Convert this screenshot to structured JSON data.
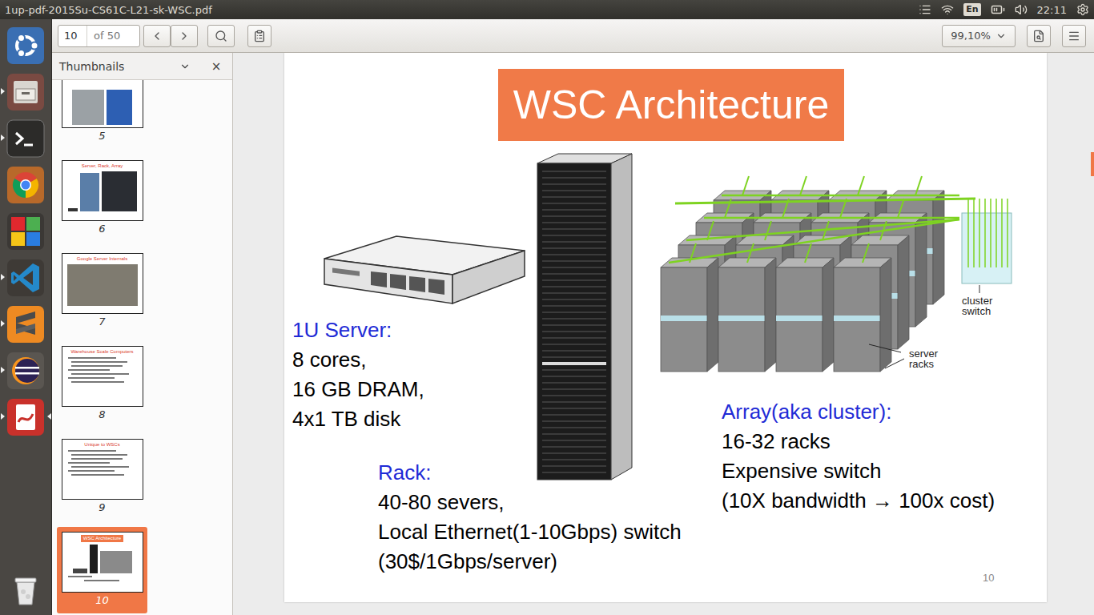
{
  "panel": {
    "title": "1up-pdf-2015Su-CS61C-L21-sk-WSC.pdf",
    "keyboard": "En",
    "time": "22:11"
  },
  "launcher": {
    "items": [
      {
        "kind": "dash",
        "running": false,
        "focused": false
      },
      {
        "kind": "files",
        "running": true,
        "focused": false
      },
      {
        "kind": "terminal",
        "running": true,
        "focused": false
      },
      {
        "kind": "chrome",
        "running": false,
        "focused": false
      },
      {
        "kind": "tiles",
        "running": false,
        "focused": false
      },
      {
        "kind": "vscode",
        "running": true,
        "focused": false
      },
      {
        "kind": "sublime",
        "running": true,
        "focused": false
      },
      {
        "kind": "eclipse",
        "running": true,
        "focused": false
      },
      {
        "kind": "pdf",
        "running": true,
        "focused": true
      },
      {
        "kind": "trash",
        "running": false,
        "focused": false
      }
    ]
  },
  "toolbar": {
    "page": "10",
    "page_count": "of 50",
    "zoom": "99,10%"
  },
  "sidebar": {
    "title": "Thumbnails",
    "close": "×",
    "thumbnails": [
      {
        "page": "5",
        "title": "",
        "kind": "photos",
        "selected": false
      },
      {
        "page": "6",
        "title": "Server, Rack, Array",
        "kind": "photo-row",
        "selected": false
      },
      {
        "page": "7",
        "title": "Google Server Internals",
        "kind": "photo",
        "selected": false
      },
      {
        "page": "8",
        "title": "Warehouse Scale Computers",
        "kind": "bullets",
        "selected": false
      },
      {
        "page": "9",
        "title": "Unique to WSCs",
        "kind": "bullets",
        "selected": false
      },
      {
        "page": "10",
        "title": "WSC Architecture",
        "kind": "diagram",
        "selected": true
      }
    ]
  },
  "slide": {
    "title": "WSC Architecture",
    "page_number": "10",
    "switch_label": [
      "cluster",
      "switch"
    ],
    "racks_label": [
      "server",
      "racks"
    ],
    "blocks": [
      {
        "heading": "1U Server:",
        "lines": [
          "8 cores,",
          "16 GB DRAM,",
          "4x1 TB disk"
        ]
      },
      {
        "heading": "Rack:",
        "lines": [
          "40-80 severs,",
          "Local Ethernet(1-10Gbps) switch",
          "(30$/1Gbps/server)"
        ]
      },
      {
        "heading": "Array(aka cluster):",
        "lines": [
          "16-32 racks",
          "Expensive switch",
          "(10X bandwidth → 100x cost)"
        ]
      }
    ]
  }
}
